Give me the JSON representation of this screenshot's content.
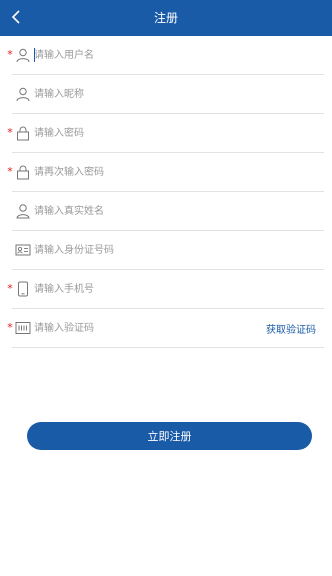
{
  "header": {
    "title": "注册"
  },
  "form": {
    "username": {
      "placeholder": "请输入用户名",
      "required": true,
      "icon": "user-icon"
    },
    "nickname": {
      "placeholder": "请输入昵称",
      "required": false,
      "icon": "user-icon"
    },
    "password": {
      "placeholder": "请输入密码",
      "required": true,
      "icon": "lock-icon"
    },
    "confirm_password": {
      "placeholder": "请再次输入密码",
      "required": true,
      "icon": "lock-icon"
    },
    "real_name": {
      "placeholder": "请输入真实姓名",
      "required": false,
      "icon": "person-icon"
    },
    "id_number": {
      "placeholder": "请输入身份证号码",
      "required": false,
      "icon": "id-card-icon"
    },
    "phone": {
      "placeholder": "请输入手机号",
      "required": true,
      "icon": "phone-icon"
    },
    "code": {
      "placeholder": "请输入验证码",
      "required": true,
      "icon": "code-icon"
    },
    "required_mark": "*",
    "get_code_label": "获取验证码"
  },
  "submit_label": "立即注册",
  "colors": {
    "primary": "#1a5ba8",
    "required": "#e02020",
    "placeholder": "#9a9a9a",
    "divider": "#e3e3e3"
  }
}
